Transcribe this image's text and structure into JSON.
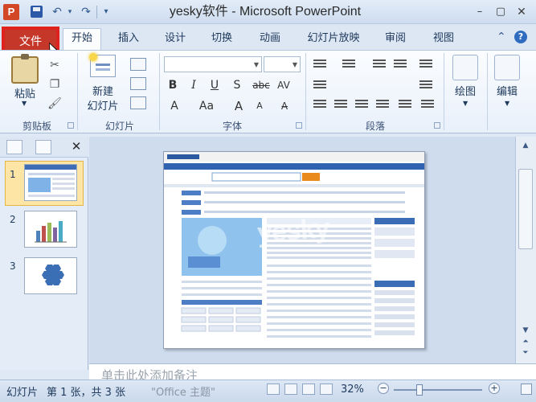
{
  "window": {
    "title": "yesky软件 - Microsoft PowerPoint",
    "app_icon_letter": "P",
    "min": "–",
    "max": "▢",
    "close": "✕"
  },
  "qat": {
    "undo": "↶",
    "redo": "↷",
    "dropdown": "▾"
  },
  "tabs": [
    {
      "label": "文件"
    },
    {
      "label": "开始"
    },
    {
      "label": "插入"
    },
    {
      "label": "设计"
    },
    {
      "label": "切换"
    },
    {
      "label": "动画"
    },
    {
      "label": "幻灯片放映"
    },
    {
      "label": "审阅"
    },
    {
      "label": "视图"
    }
  ],
  "active_tab": "开始",
  "ribbon": {
    "clipboard": {
      "paste": "粘贴",
      "label": "剪贴板"
    },
    "slides": {
      "new_slide_line1": "新建",
      "new_slide_line2": "幻灯片",
      "label": "幻灯片"
    },
    "font": {
      "label": "字体",
      "bold": "B",
      "italic": "I",
      "underline": "U",
      "shadow": "S",
      "strike": "abc",
      "spacing": "AV",
      "font_color": "A",
      "change_case": "Aa",
      "grow": "A",
      "shrink": "A"
    },
    "paragraph": {
      "label": "段落"
    },
    "drawing": {
      "label": "绘图"
    },
    "editing": {
      "label": "编辑"
    }
  },
  "pane": {
    "close": "✕"
  },
  "thumbnails": [
    {
      "number": "1"
    },
    {
      "number": "2"
    },
    {
      "number": "3"
    }
  ],
  "notes_placeholder": "单击此处添加备注",
  "status": {
    "slide_label": "幻灯片",
    "slide_info": "第 1 张，共 3 张",
    "theme": "\"Office 主题\"",
    "zoom": "32%",
    "zoom_out": "−",
    "zoom_in": "+"
  },
  "slide_content": {
    "watermark": "yesky"
  }
}
